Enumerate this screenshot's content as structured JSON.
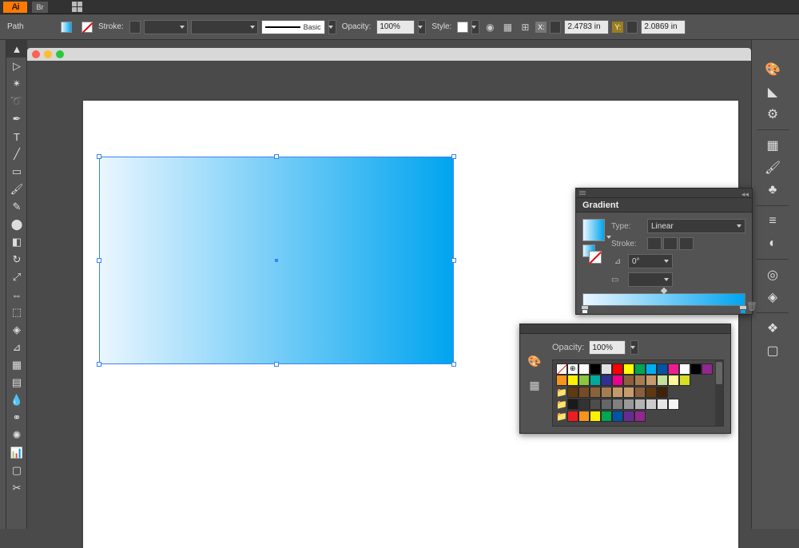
{
  "app": {
    "logo": "Ai",
    "bridge": "Br"
  },
  "controlbar": {
    "selection_label": "Path",
    "stroke_label": "Stroke:",
    "brush_label": "Basic",
    "opacity_label": "Opacity:",
    "opacity_value": "100%",
    "style_label": "Style:",
    "x_label": "X:",
    "x_value": "2.4783 in",
    "y_label": "Y:",
    "y_value": "2.0869 in"
  },
  "gradient": {
    "title": "Gradient",
    "type_label": "Type:",
    "type_value": "Linear",
    "stroke_label": "Stroke:",
    "angle_value": "0°"
  },
  "swatches": {
    "opacity_label": "Opacity:",
    "opacity_value": "100%",
    "row1": [
      "#ffffff",
      "#000000",
      "#e1e1e1",
      "#ff0000",
      "#ffff00",
      "#00a651",
      "#00aeef",
      "#0054a6",
      "#ed1c91",
      "#ffffff",
      "#000000",
      "#92278f",
      "#f7941d",
      "#fff200",
      "#8dc63f",
      "#00a99d",
      "#2e3192",
      "#ec008c",
      "#8b5e3c",
      "#a67c52",
      "#c49a6c",
      "#c4df9b",
      "#fff799",
      "#d7df23"
    ],
    "row2": [
      "#603913",
      "#754c24",
      "#8c6239",
      "#a67c52",
      "#c49a6c",
      "#c69c6d",
      "#8b5e3c",
      "#603913",
      "#42210b"
    ],
    "row3": [
      "#1a1a1a",
      "#333333",
      "#4d4d4d",
      "#666666",
      "#808080",
      "#999999",
      "#b3b3b3",
      "#cccccc",
      "#e6e6e6",
      "#f2f2f2"
    ],
    "row4": [
      "#ed1c24",
      "#f7941d",
      "#fff200",
      "#00a651",
      "#0054a6",
      "#662d91",
      "#92278f"
    ]
  }
}
